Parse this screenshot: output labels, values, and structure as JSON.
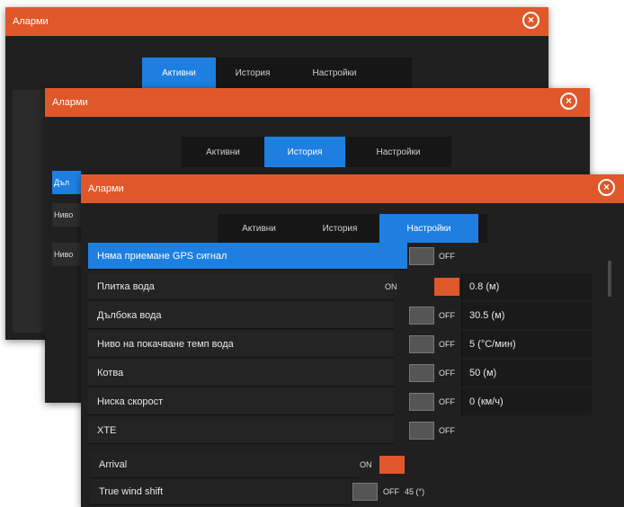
{
  "windows": {
    "back": {
      "title": "Аларми",
      "tabs": [
        {
          "label": "Активни",
          "active": true
        },
        {
          "label": "История",
          "active": false
        },
        {
          "label": "Настройки",
          "active": false
        }
      ]
    },
    "middle": {
      "title": "Аларми",
      "tabs": [
        {
          "label": "Активни",
          "active": false
        },
        {
          "label": "История",
          "active": true
        },
        {
          "label": "Настройки",
          "active": false
        }
      ],
      "list_items": [
        "Дъл",
        "Ниво",
        "Ниво"
      ]
    },
    "front": {
      "title": "Аларми",
      "tabs": [
        {
          "label": "Активни",
          "active": false
        },
        {
          "label": "История",
          "active": false
        },
        {
          "label": "Настройки",
          "active": true
        }
      ],
      "settings": [
        {
          "label": "Няма приемане GPS сигнал",
          "state": "OFF",
          "value": ""
        },
        {
          "label": "Плитка вода",
          "state": "ON",
          "value": "0.8 (м)"
        },
        {
          "label": "Дълбока вода",
          "state": "OFF",
          "value": "30.5 (м)"
        },
        {
          "label": "Ниво на покачване темп вода",
          "state": "OFF",
          "value": "5 (°C/мин)"
        },
        {
          "label": "Котва",
          "state": "OFF",
          "value": "50 (м)"
        },
        {
          "label": "Ниска скорост",
          "state": "OFF",
          "value": "0 (км/ч)"
        },
        {
          "label": "XTE",
          "state": "OFF",
          "value": ""
        },
        {
          "label": "Arrival",
          "state": "ON",
          "value": ""
        },
        {
          "label": "True wind shift",
          "state": "OFF",
          "value": "45 (°)"
        }
      ]
    }
  },
  "icons": {
    "close": "close-circle-icon"
  },
  "colors": {
    "accent": "#e0572a",
    "selected": "#1e7fe0",
    "background": "#202020"
  }
}
